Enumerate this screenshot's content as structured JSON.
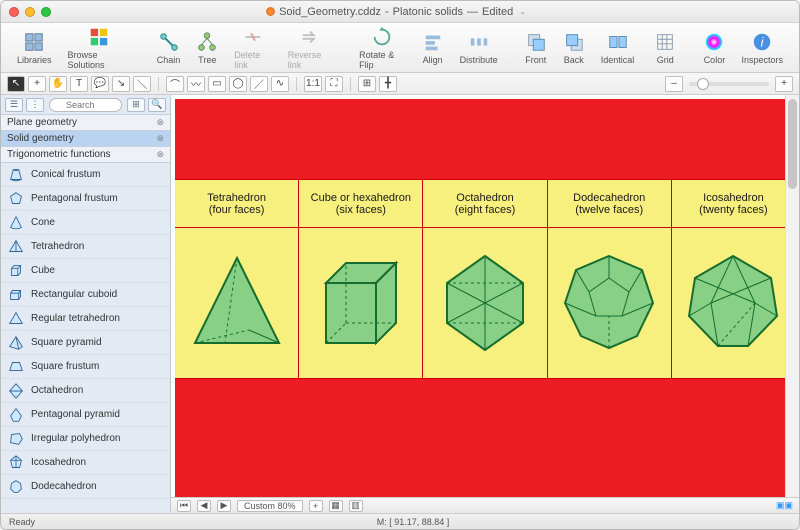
{
  "title": {
    "file": "Soid_Geometry.cddz",
    "doc": "Platonic solids",
    "suffix": "Edited"
  },
  "toolbar": {
    "libraries": "Libraries",
    "browse": "Browse Solutions",
    "chain": "Chain",
    "tree": "Tree",
    "delete": "Delete link",
    "reverse": "Reverse link",
    "rotate": "Rotate & Flip",
    "align": "Align",
    "distribute": "Distribute",
    "front": "Front",
    "back": "Back",
    "identical": "Identical",
    "grid": "Grid",
    "color": "Color",
    "inspectors": "Inspectors"
  },
  "search": {
    "placeholder": "Search"
  },
  "categories": [
    {
      "label": "Plane geometry",
      "selected": false
    },
    {
      "label": "Solid geometry",
      "selected": true
    },
    {
      "label": "Trigonometric functions",
      "selected": false
    }
  ],
  "shapes": [
    "Conical frustum",
    "Pentagonal frustum",
    "Cone",
    "Tetrahedron",
    "Cube",
    "Rectangular cuboid",
    "Regular tetrahedron",
    "Square pyramid",
    "Square frustum",
    "Octahedron",
    "Pentagonal pyramid",
    "Irregular polyhedron",
    "Icosahedron",
    "Dodecahedron"
  ],
  "solids": [
    {
      "name": "Tetrahedron",
      "faces": "(four faces)"
    },
    {
      "name": "Cube or hexahedron",
      "faces": "(six faces)"
    },
    {
      "name": "Octahedron",
      "faces": "(eight faces)"
    },
    {
      "name": "Dodecahedron",
      "faces": "(twelve faces)"
    },
    {
      "name": "Icosahedron",
      "faces": "(twenty faces)"
    }
  ],
  "zoom": {
    "label": "Custom 80%"
  },
  "status": {
    "ready": "Ready",
    "coords": "M: [ 91.17, 88.84 ]"
  },
  "colors": {
    "shape_fill": "#88d085",
    "shape_stroke": "#166e2e"
  }
}
